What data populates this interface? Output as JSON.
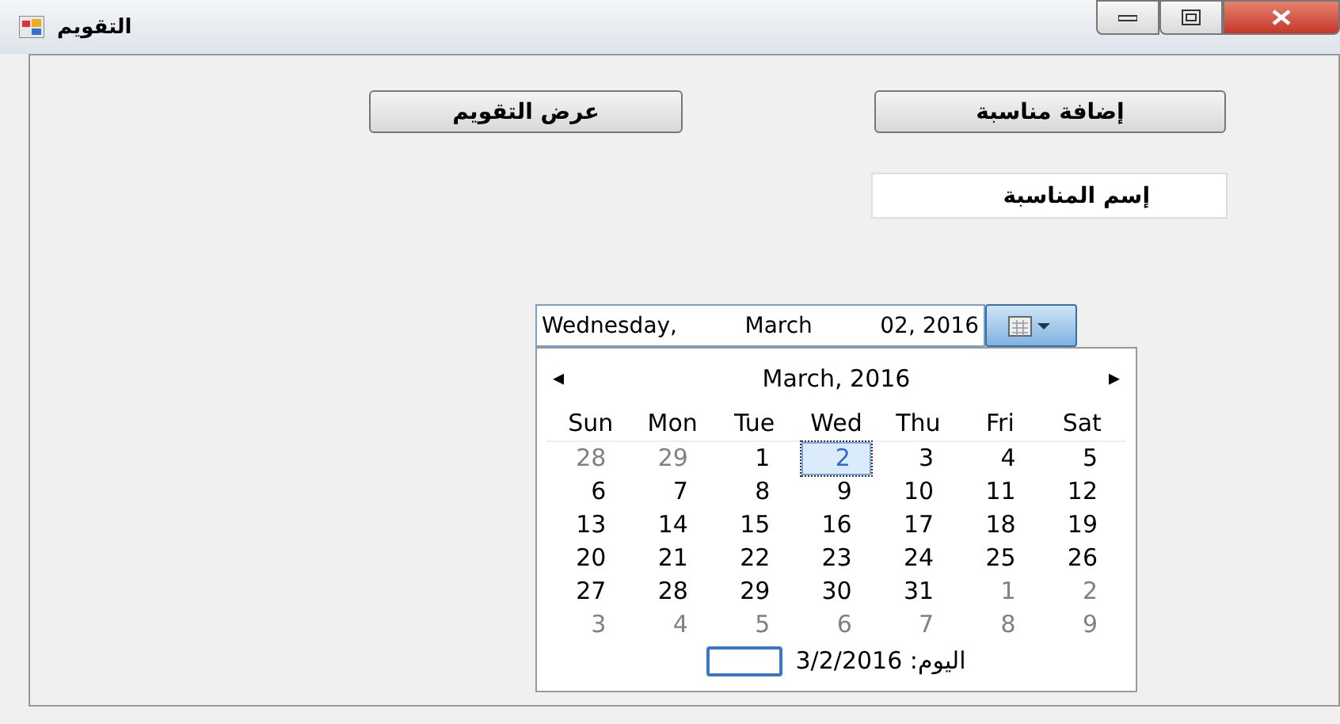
{
  "window": {
    "title": "التقويم"
  },
  "buttons": [
    {
      "label": "إضافة مناسبة"
    },
    {
      "label": "عرض التقويم"
    }
  ],
  "event_name_field": {
    "value": "إسم المناسبة"
  },
  "date_picker": {
    "weekday": "Wednesday,",
    "month": "March",
    "day_year": "02, 2016"
  },
  "calendar": {
    "prev": "◂",
    "title": "March, 2016",
    "next": "▸",
    "weekdays": [
      "Sat",
      "Fri",
      "Thu",
      "Wed",
      "Tue",
      "Mon",
      "Sun"
    ],
    "days": [
      {
        "text": "5",
        "muted": false,
        "selected": false
      },
      {
        "text": "4",
        "muted": false,
        "selected": false
      },
      {
        "text": "3",
        "muted": false,
        "selected": false
      },
      {
        "text": "2",
        "muted": false,
        "selected": true
      },
      {
        "text": "1",
        "muted": false,
        "selected": false
      },
      {
        "text": "29",
        "muted": true,
        "selected": false
      },
      {
        "text": "28",
        "muted": true,
        "selected": false
      },
      {
        "text": "12",
        "muted": false,
        "selected": false
      },
      {
        "text": "11",
        "muted": false,
        "selected": false
      },
      {
        "text": "10",
        "muted": false,
        "selected": false
      },
      {
        "text": "9",
        "muted": false,
        "selected": false
      },
      {
        "text": "8",
        "muted": false,
        "selected": false
      },
      {
        "text": "7",
        "muted": false,
        "selected": false
      },
      {
        "text": "6",
        "muted": false,
        "selected": false
      },
      {
        "text": "19",
        "muted": false,
        "selected": false
      },
      {
        "text": "18",
        "muted": false,
        "selected": false
      },
      {
        "text": "17",
        "muted": false,
        "selected": false
      },
      {
        "text": "16",
        "muted": false,
        "selected": false
      },
      {
        "text": "15",
        "muted": false,
        "selected": false
      },
      {
        "text": "14",
        "muted": false,
        "selected": false
      },
      {
        "text": "13",
        "muted": false,
        "selected": false
      },
      {
        "text": "26",
        "muted": false,
        "selected": false
      },
      {
        "text": "25",
        "muted": false,
        "selected": false
      },
      {
        "text": "24",
        "muted": false,
        "selected": false
      },
      {
        "text": "23",
        "muted": false,
        "selected": false
      },
      {
        "text": "22",
        "muted": false,
        "selected": false
      },
      {
        "text": "21",
        "muted": false,
        "selected": false
      },
      {
        "text": "20",
        "muted": false,
        "selected": false
      },
      {
        "text": "2",
        "muted": true,
        "selected": false
      },
      {
        "text": "1",
        "muted": true,
        "selected": false
      },
      {
        "text": "31",
        "muted": false,
        "selected": false
      },
      {
        "text": "30",
        "muted": false,
        "selected": false
      },
      {
        "text": "29",
        "muted": false,
        "selected": false
      },
      {
        "text": "28",
        "muted": false,
        "selected": false
      },
      {
        "text": "27",
        "muted": false,
        "selected": false
      },
      {
        "text": "9",
        "muted": true,
        "selected": false
      },
      {
        "text": "8",
        "muted": true,
        "selected": false
      },
      {
        "text": "7",
        "muted": true,
        "selected": false
      },
      {
        "text": "6",
        "muted": true,
        "selected": false
      },
      {
        "text": "5",
        "muted": true,
        "selected": false
      },
      {
        "text": "4",
        "muted": true,
        "selected": false
      },
      {
        "text": "3",
        "muted": true,
        "selected": false
      }
    ],
    "today": "اليوم: 3/2/2016"
  }
}
